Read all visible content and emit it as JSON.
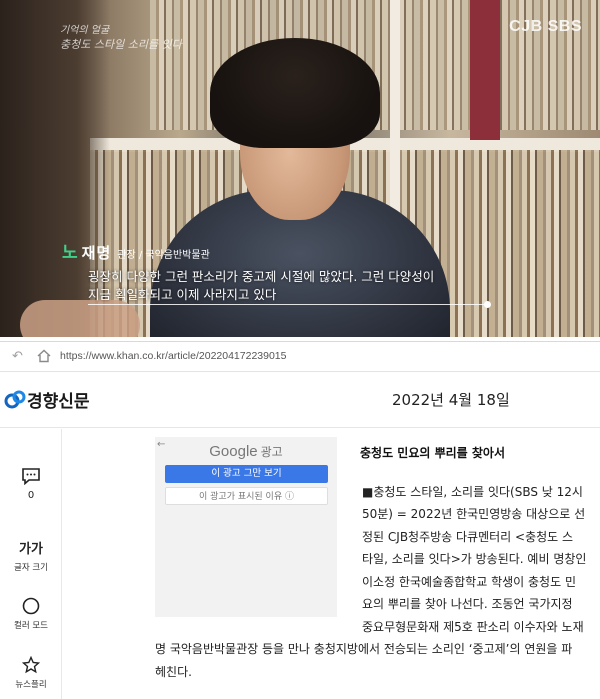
{
  "video": {
    "program_logo_line1": "기억의 얼굴",
    "program_logo_line2": "충청도 스타일 소리를 잇다",
    "broadcaster": "CJB SBS",
    "caption_surname": "노",
    "caption_given": "재명",
    "caption_title": "관장 / 국악음반박물관",
    "subtitle_line1": "굉장히 다양한 그런 판소리가 중고제 시절에 많았다. 그런 다양성이",
    "subtitle_line2": "지금 획일화되고 이제 사라지고 있다"
  },
  "browser": {
    "url": "https://www.khan.co.kr/article/202204172239015"
  },
  "masthead": {
    "logo_text": "경향신문",
    "date": "2022년 4월 18일"
  },
  "sidebar": {
    "comment_count": "0",
    "font_size_label": "글자 크기",
    "font_size_glyph": "가가",
    "color_mode_label": "컬러 모드",
    "newsplay_label": "뉴스플리"
  },
  "ad": {
    "back_arrow": "←",
    "brand": "Google",
    "brand_suffix": "광고",
    "stop_button": "이 광고 그만 보기",
    "why_button": "이 광고가 표시된 이유 ⓘ"
  },
  "article": {
    "headline": "충청도 민요의 뿌리를 찾아서",
    "lines": [
      "■충청도 스타일, 소리를 잇다(SBS 낮 12시",
      "50분) = 2022년 한국민영방송 대상으로 선",
      "정된 CJB청주방송 다큐멘터리 <충청도 스",
      "타일, 소리를 잇다>가 방송된다. 예비 명창인",
      "이소정 한국예술종합학교 학생이 충청도 민",
      "요의 뿌리를 찾아 나선다. 조동언 국가지정",
      "중요무형문화재 제5호 판소리 이수자와 노재",
      "명 국악음반박물관장 등을 만나 충청지방에서 전승되는 소리인 ‘중고제’의 연원을 파",
      "헤친다."
    ]
  }
}
